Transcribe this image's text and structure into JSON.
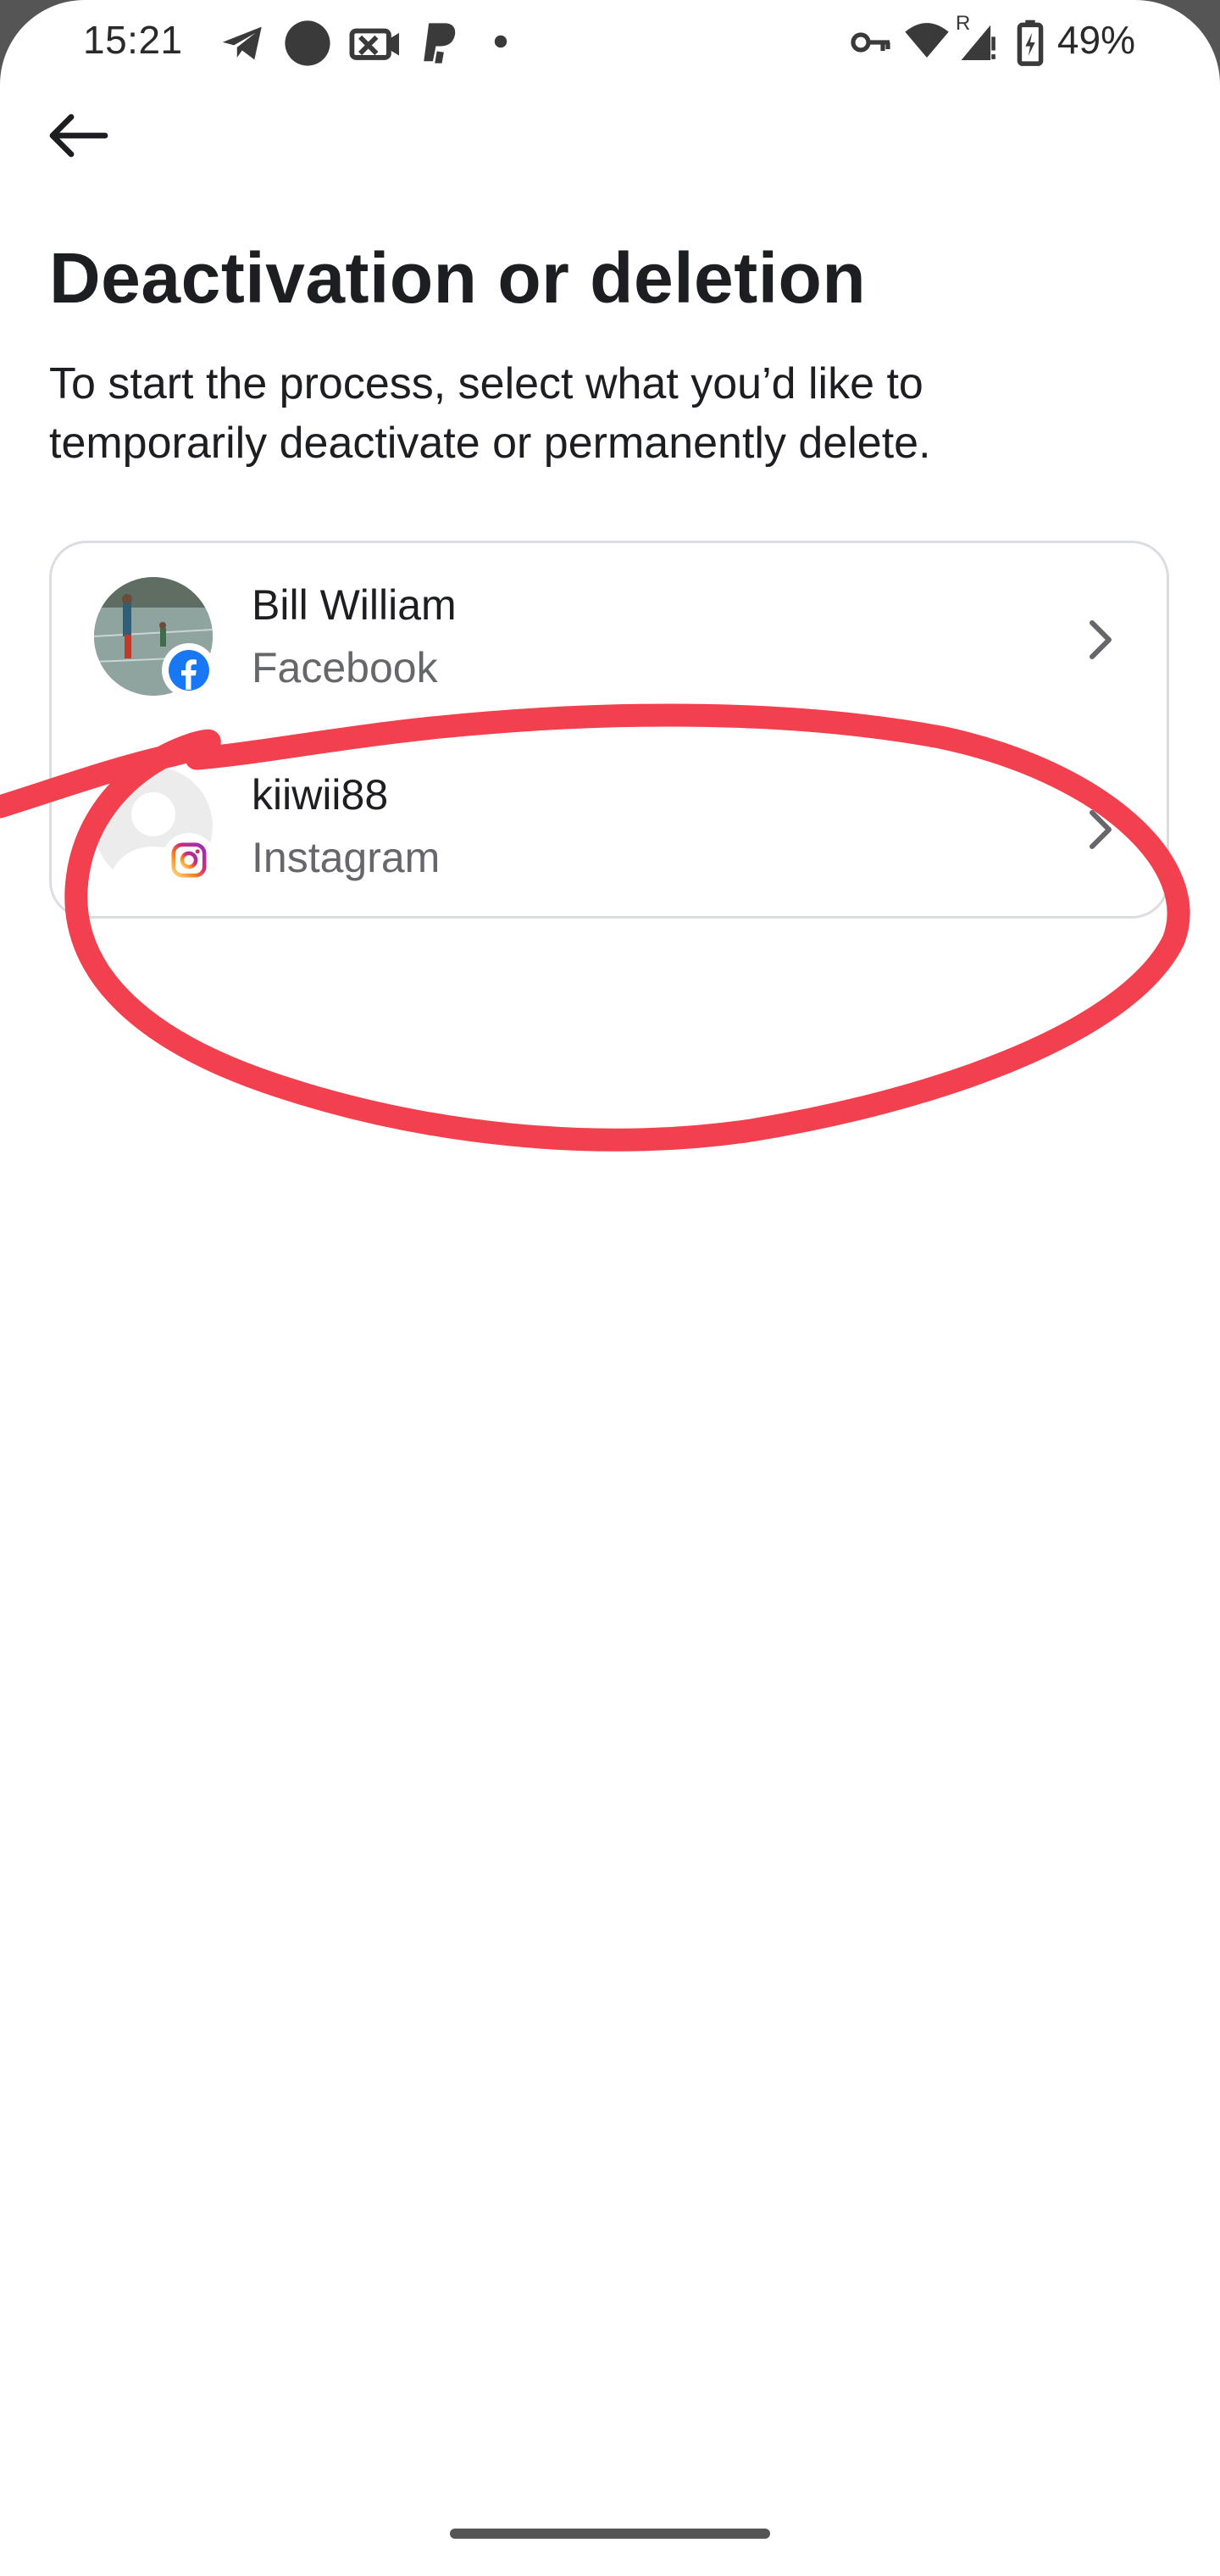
{
  "status_bar": {
    "time": "15:21",
    "battery": "49%",
    "icons": [
      "telegram-icon",
      "circle-icon",
      "camera-off-icon",
      "paypal-icon",
      "dot-icon",
      "vpn-key-icon",
      "wifi-icon",
      "signal-icon",
      "battery-icon"
    ]
  },
  "header": {
    "back_icon": "arrow-left-icon",
    "title": "Deactivation or deletion",
    "subtitle": "To start the process, select what you’d like to temporarily deactivate or permanently delete."
  },
  "accounts": [
    {
      "name": "Bill William",
      "platform": "Facebook",
      "badge_icon": "facebook-icon",
      "brand_color": "#1877f2"
    },
    {
      "name": "kiiwii88",
      "platform": "Instagram",
      "badge_icon": "instagram-icon",
      "brand_color": "#e1306c"
    }
  ],
  "annotation": {
    "color": "#f2404f"
  },
  "colors": {
    "text_primary": "#1c1e21",
    "text_secondary": "#65676b",
    "border": "#dadde1"
  }
}
